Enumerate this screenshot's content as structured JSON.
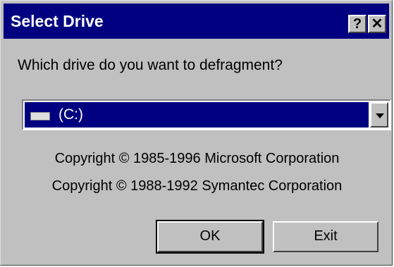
{
  "window": {
    "title": "Select Drive",
    "help_button": "?",
    "close_button": "✕"
  },
  "prompt": "Which drive do you want to defragment?",
  "drive_select": {
    "selected": "(C:)"
  },
  "copyright": {
    "line1": "Copyright © 1985-1996 Microsoft Corporation",
    "line2": "Copyright © 1988-1992 Symantec Corporation"
  },
  "buttons": {
    "ok": "OK",
    "exit": "Exit"
  },
  "colors": {
    "titlebar": "#000080",
    "face": "#c0c0c0",
    "selection": "#000080"
  }
}
